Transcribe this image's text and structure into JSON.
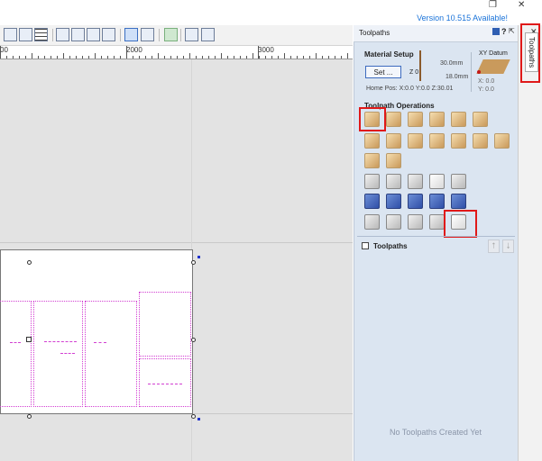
{
  "title_bar": {
    "version_notice": "Version 10.515 Available!",
    "restore_glyph": "❐",
    "close_glyph": "✕"
  },
  "ruler": {
    "labels": [
      "00",
      "2000",
      "3000"
    ]
  },
  "toolpaths_panel": {
    "header": "Toolpaths",
    "header_buttons": [
      "?",
      "⇱",
      "✕"
    ],
    "material_setup": {
      "title": "Material Setup",
      "set_button": "Set ...",
      "z_zero": "Z 0",
      "thickness": "30.0mm",
      "clearance": "18.0mm",
      "home_pos": "Home Pos:  X:0.0 Y:0.0 Z:30.01",
      "xy_datum_title": "XY Datum",
      "x_value": "X: 0.0",
      "y_value": "Y: 0.0"
    },
    "operations_title": "Toolpath Operations",
    "toolpaths_list_title": "Toolpaths",
    "empty_message": "No Toolpaths Created Yet"
  },
  "side_tab": {
    "label": "Toolpaths"
  },
  "colors": {
    "panel_bg": "#dbe5f1",
    "highlight": "#e01919",
    "link": "#1a73d9",
    "vector": "#d23fd2"
  },
  "icons": {
    "toolbar": [
      "2d-view-icon",
      "3d-view-icon",
      "grid-icon",
      "pan-icon",
      "zoom-all-icon",
      "zoom-box-icon",
      "zoom-in-icon",
      "select-icon",
      "transform-icon",
      "material-icon",
      "layers-icon",
      "split-view-icon"
    ],
    "operations": [
      "profile-toolpath-icon",
      "pocket-toolpath-icon",
      "drilling-toolpath-icon",
      "quick-engrave-icon",
      "vcarve-icon",
      "inlay-icon",
      "chamfer-icon",
      "fluting-icon",
      "prism-icon",
      "texture-icon",
      "fluting2-icon",
      "moulding-icon",
      "3d-roughing-icon",
      "3d-finish-icon",
      "sphere-icon",
      "merge-icon",
      "edit-toolpath-icon",
      "copy-toolpath-icon",
      "delete-toolpath-icon",
      "calculate-icon",
      "preview-all-icon",
      "preview-selected-icon",
      "preview-home-icon",
      "preview-reset-icon",
      "preview-tool-icon",
      "tool-database-icon",
      "time-estimate-icon",
      "template-icon",
      "visualize-icon",
      "save-toolpath-icon"
    ]
  }
}
